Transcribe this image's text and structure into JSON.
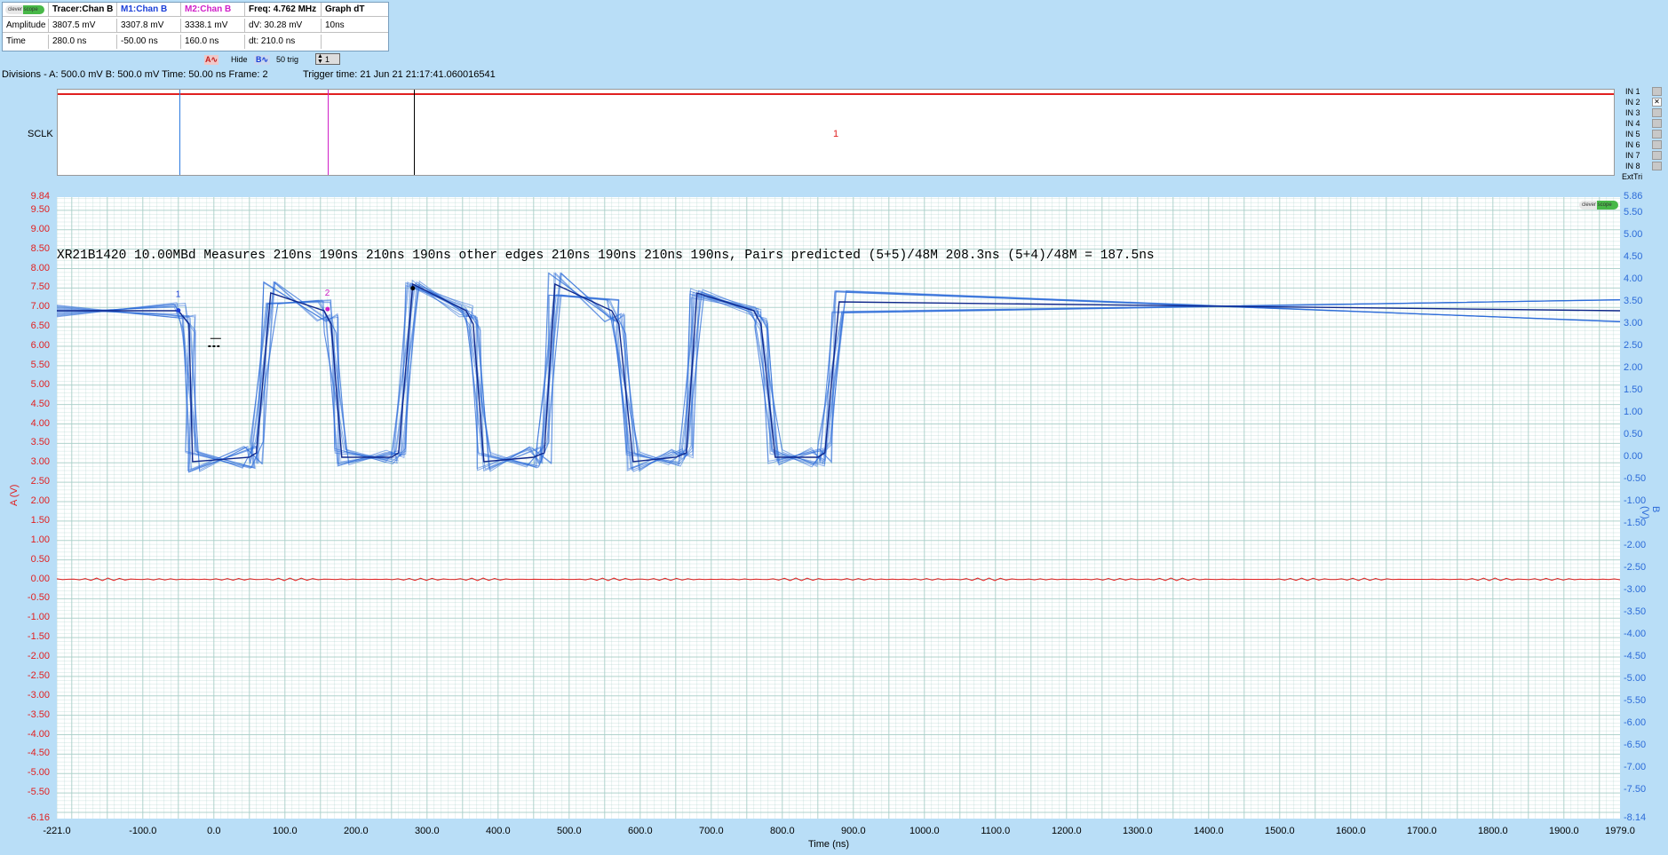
{
  "measurements": {
    "logo_text": "clever scope",
    "headers": [
      "Tracer:Chan B",
      "M1:Chan B",
      "M2:Chan B",
      "Freq: 4.762 MHz",
      "Graph dT"
    ],
    "header_colors": [
      "#000000",
      "#1a3fd8",
      "#d020c8",
      "#000000",
      "#000000"
    ],
    "rows": [
      {
        "label": "Amplitude",
        "values": [
          "3807.5 mV",
          "3307.8 mV",
          "3338.1 mV",
          "dV: 30.28 mV",
          "10ns"
        ]
      },
      {
        "label": "Time",
        "values": [
          "280.0 ns",
          "-50.00 ns",
          "160.0 ns",
          "dt:  210.0 ns",
          ""
        ]
      }
    ]
  },
  "controls": {
    "a_icon": "A-waveform-icon",
    "hide_label": "Hide",
    "b_icon": "B-waveform-icon",
    "trig_label": "50 trig",
    "frame_spin_value": "1"
  },
  "status": {
    "divisions": "Divisions -  A: 500.0 mV   B: 500.0 mV   Time: 50.00 ns  Frame: 2",
    "trigger_time": "Trigger time: 21 Jun 21 21:17:41.060016541"
  },
  "digital": {
    "channel_label": "SCLK",
    "marker_label": "1",
    "inputs": [
      "IN 1",
      "IN 2",
      "IN 3",
      "IN 4",
      "IN 5",
      "IN 6",
      "IN 7",
      "IN 8",
      "ExtTri"
    ],
    "checked_input": "IN 2"
  },
  "plot": {
    "annotation": "XR21B1420  10.00MBd Measures  210ns 190ns 210ns 190ns  other edges  210ns 190ns 210ns 190ns,  Pairs predicted  (5+5)/48M  208.3ns (5+4)/48M = 187.5ns",
    "logo_text": "clever scope",
    "marker_labels": [
      "1",
      "2"
    ],
    "colors": {
      "chan_a": "#e02020",
      "chan_b": "#2c6bd8",
      "chan_b_dark": "#10288c",
      "m1": "#1a3fd8",
      "m2": "#d020c8",
      "grid": "#a8cfc8"
    }
  },
  "chart_data": {
    "type": "line",
    "xlabel": "Time (ns)",
    "ylabel_left": "A (V)",
    "ylabel_right": "B (V)",
    "xlim": [
      -221.0,
      1979.0
    ],
    "ylim_left": [
      -6.16,
      9.84
    ],
    "ylim_right": [
      -8.14,
      5.86
    ],
    "x_tick_labels": [
      "-221.0",
      "-100.0",
      "0.0",
      "100.0",
      "200.0",
      "300.0",
      "400.0",
      "500.0",
      "600.0",
      "700.0",
      "800.0",
      "900.0",
      "1000.0",
      "1100.0",
      "1200.0",
      "1300.0",
      "1400.0",
      "1500.0",
      "1600.0",
      "1700.0",
      "1800.0",
      "1900.0",
      "1979.0"
    ],
    "y_left_tick_labels": [
      "9.84",
      "9.50",
      "9.00",
      "8.50",
      "8.00",
      "7.50",
      "7.00",
      "6.50",
      "6.00",
      "5.50",
      "5.00",
      "4.50",
      "4.00",
      "3.50",
      "3.00",
      "2.50",
      "2.00",
      "1.50",
      "1.00",
      "0.50",
      "0.00",
      "-0.50",
      "-1.00",
      "-1.50",
      "-2.00",
      "-2.50",
      "-3.00",
      "-3.50",
      "-4.00",
      "-4.50",
      "-5.00",
      "-5.50",
      "-6.16"
    ],
    "y_right_tick_labels": [
      "5.86",
      "5.50",
      "5.00",
      "4.50",
      "4.00",
      "3.50",
      "3.00",
      "2.50",
      "2.00",
      "1.50",
      "1.00",
      "0.50",
      "0.00",
      "-0.50",
      "-1.00",
      "-1.50",
      "-2.00",
      "-2.50",
      "-3.00",
      "-3.50",
      "-4.00",
      "-4.50",
      "-5.00",
      "-5.50",
      "-6.00",
      "-6.50",
      "-7.00",
      "-7.50",
      "-8.14"
    ],
    "series": [
      {
        "channel": "A",
        "x": [
          -221,
          1979
        ],
        "y": [
          0.0,
          0.0
        ]
      },
      {
        "channel": "B",
        "x": [
          -221,
          -50,
          -35,
          -30,
          50,
          60,
          80,
          155,
          165,
          180,
          250,
          260,
          280,
          355,
          365,
          380,
          450,
          465,
          480,
          560,
          570,
          590,
          650,
          665,
          680,
          760,
          770,
          790,
          850,
          860,
          880,
          1979
        ],
        "y": [
          3.3,
          3.3,
          3.0,
          -0.1,
          -0.0,
          0.1,
          3.7,
          3.3,
          3.0,
          0.0,
          0.0,
          0.1,
          3.9,
          3.3,
          3.0,
          -0.1,
          0.0,
          0.1,
          3.9,
          3.3,
          3.0,
          -0.1,
          0.0,
          0.1,
          3.7,
          3.3,
          3.0,
          0.0,
          0.0,
          0.1,
          3.5,
          3.3
        ]
      }
    ],
    "markers": [
      {
        "name": "1",
        "x": -50.0,
        "y": 3.3078
      },
      {
        "name": "2",
        "x": 160.0,
        "y": 3.3381
      },
      {
        "name": "tracer",
        "x": 280.0,
        "y": 3.8075
      }
    ]
  }
}
